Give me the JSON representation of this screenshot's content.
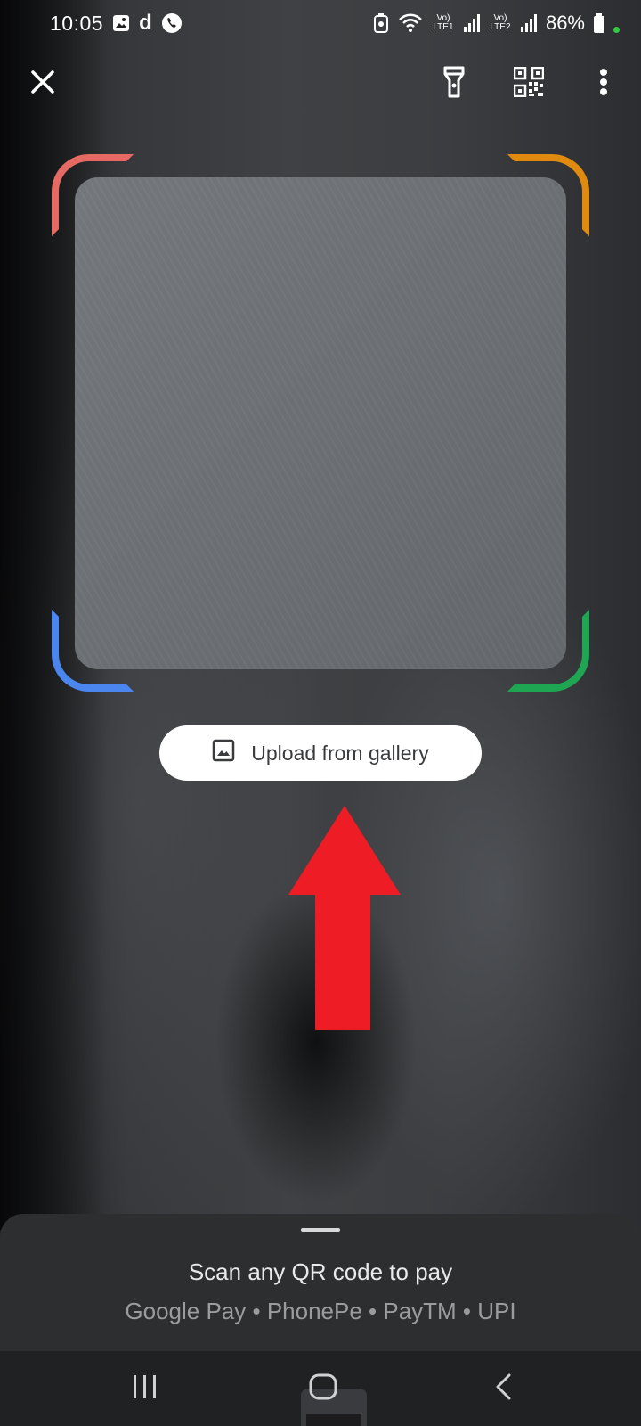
{
  "status_bar": {
    "time": "10:05",
    "app_letter": "d",
    "lte1_label": "Vo) LTE1",
    "lte2_label": "Vo) LTE2",
    "battery": "86%"
  },
  "toolbar": {
    "icons": [
      "close-icon",
      "flashlight-icon",
      "qr-code-icon",
      "more-vert-icon"
    ]
  },
  "scanner": {
    "corner_colors": {
      "top_left": "#e56a63",
      "top_right": "#e08a10",
      "bottom_left": "#4a86ee",
      "bottom_right": "#1ea653"
    }
  },
  "upload": {
    "label": "Upload from gallery",
    "icon": "image-icon"
  },
  "annotation": {
    "arrow_color": "#ee1c24"
  },
  "bottom_sheet": {
    "title": "Scan any QR code to pay",
    "subtitle": "Google Pay • PhonePe • PayTM • UPI"
  },
  "nav_bar": {
    "icons": [
      "recent-apps-icon",
      "home-icon",
      "back-icon"
    ]
  }
}
